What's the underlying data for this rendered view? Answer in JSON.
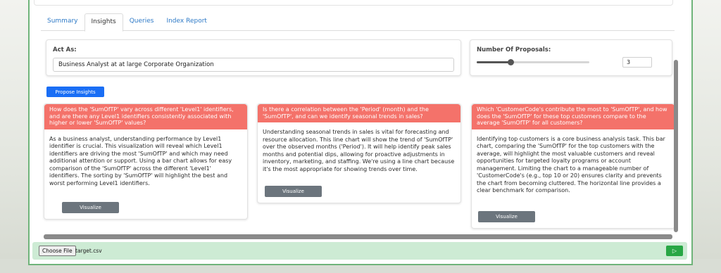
{
  "tabs": [
    {
      "label": "Summary"
    },
    {
      "label": "Insights"
    },
    {
      "label": "Queries"
    },
    {
      "label": "Index Report"
    }
  ],
  "active_tab": "Insights",
  "act_as": {
    "label": "Act As:",
    "value": "Business Analyst at at large Corporate Organization"
  },
  "proposals": {
    "label": "Number Of Proposals:",
    "value": "3",
    "slider_fraction": 0.3
  },
  "propose_button": "Propose Insights",
  "insights": [
    {
      "question": "How does the 'SumOfTP' vary across different 'Level1' identifiers, and are there any Level1 identifiers consistently associated with higher or lower 'SumOfTP' values?",
      "body": "As a business analyst, understanding performance by Level1 identifier is crucial. This visualization will reveal which Level1 identifiers are driving the most 'SumOfTP' and which may need additional attention or support. Using a bar chart allows for easy comparison of the 'SumOfTP' across the different 'Level1' identifiers. The sorting by 'SumOfTP' will highlight the best and worst performing Level1 identifiers.",
      "button": "Visualize"
    },
    {
      "question": "Is there a correlation between the 'Period' (month) and the 'SumOfTP', and can we identify seasonal trends in sales?",
      "body": "Understanding seasonal trends in sales is vital for forecasting and resource allocation. This line chart will show the trend of 'SumOfTP' over the observed months ('Period'). It will help identify peak sales months and potential dips, allowing for proactive adjustments in inventory, marketing, and staffing. We're using a line chart because it's the most appropriate for showing trends over time.",
      "button": "Visualize"
    },
    {
      "question": "Which 'CustomerCode's contribute the most to 'SumOfTP', and how does the 'SumOfTP' for these top customers compare to the average 'SumOfTP' for all customers?",
      "body": "Identifying top customers is a core business analysis task. This bar chart, comparing the 'SumOfTP' for the top customers with the average, will highlight the most valuable customers and reveal opportunities for targeted loyalty programs or account management. Limiting the chart to a manageable number of 'CustomerCode's (e.g., top 10 or 20) ensures clarity and prevents the chart from becoming cluttered. The horizontal line provides a clear benchmark for comparison.",
      "button": "Visualize"
    }
  ],
  "footer": {
    "file_button": "Choose File",
    "file_name": "target.csv",
    "send_icon": "play-icon"
  },
  "colors": {
    "insight_header": "#f4726a",
    "primary": "#1a6ef5",
    "secondary": "#6c757d",
    "success": "#28a745",
    "footer_bg": "#cdebd4"
  }
}
